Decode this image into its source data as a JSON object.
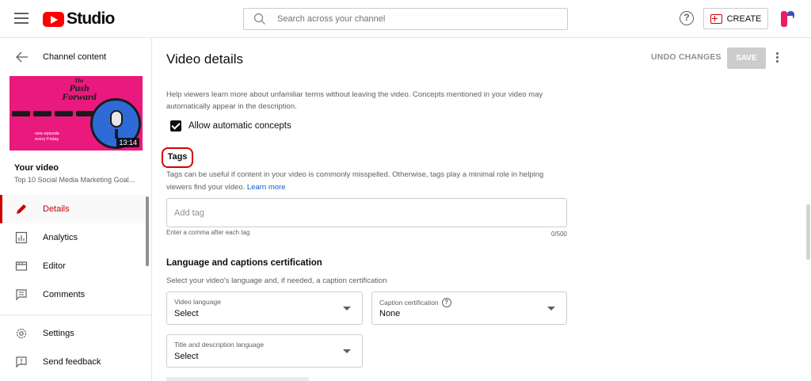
{
  "header": {
    "logo_text": "Studio",
    "search_placeholder": "Search across your channel",
    "help_symbol": "?",
    "create_label": "CREATE"
  },
  "sidebar": {
    "back_label": "Channel content",
    "thumbnail": {
      "title_small": "The",
      "title_main": "Push Forward",
      "subtitle_line1": "new episode",
      "subtitle_line2": "every Friday",
      "duration": "13:14"
    },
    "your_video_label": "Your video",
    "video_title": "Top 10 Social Media Marketing Goal...",
    "nav": [
      {
        "label": "Details",
        "icon": "pencil-icon",
        "active": true
      },
      {
        "label": "Analytics",
        "icon": "analytics-icon"
      },
      {
        "label": "Editor",
        "icon": "editor-icon"
      },
      {
        "label": "Comments",
        "icon": "comments-icon"
      }
    ],
    "bottom_nav": [
      {
        "label": "Settings",
        "icon": "gear-icon"
      },
      {
        "label": "Send feedback",
        "icon": "feedback-icon"
      }
    ]
  },
  "main": {
    "title": "Video details",
    "undo_label": "UNDO CHANGES",
    "save_label": "SAVE",
    "concepts_help": "Help viewers learn more about unfamiliar terms without leaving the video. Concepts mentioned in your video may automatically appear in the description.",
    "allow_concepts_label": "Allow automatic concepts",
    "allow_concepts_checked": true,
    "tags": {
      "heading": "Tags",
      "help": "Tags can be useful if content in your video is commonly misspelled. Otherwise, tags play a minimal role in helping viewers find your video.",
      "learn_more": "Learn more",
      "placeholder": "Add tag",
      "hint": "Enter a comma after each tag",
      "count": "0/500"
    },
    "language": {
      "heading": "Language and captions certification",
      "help": "Select your video's language and, if needed, a caption certification",
      "video_language_label": "Video language",
      "video_language_value": "Select",
      "caption_cert_label": "Caption certification",
      "caption_cert_value": "None",
      "title_lang_label": "Title and description language",
      "title_lang_value": "Select"
    }
  },
  "colors": {
    "accent_red": "#cc0000",
    "highlight_red": "#d80000",
    "link_blue": "#065fd4",
    "thumbnail_pink": "#e9197e"
  }
}
